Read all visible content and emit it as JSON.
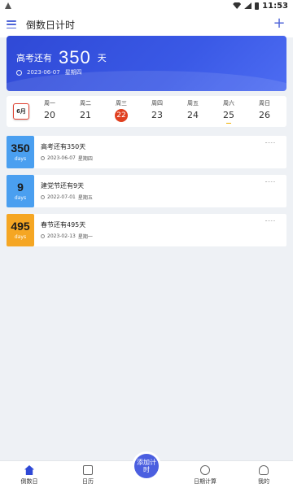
{
  "status_bar": {
    "time": "11:53"
  },
  "header": {
    "title": "倒数日计时",
    "add_icon": "plus-icon",
    "menu_icon": "menu-icon"
  },
  "banner": {
    "prefix": "高考还有",
    "number": "350",
    "unit": "天",
    "date": "2023-06-07",
    "weekday": "星期四"
  },
  "week": {
    "calendar_label": "6月",
    "days": [
      {
        "weekday": "周一",
        "day": "20"
      },
      {
        "weekday": "周二",
        "day": "21"
      },
      {
        "weekday": "周三",
        "day": "22"
      },
      {
        "weekday": "周四",
        "day": "23"
      },
      {
        "weekday": "周五",
        "day": "24"
      },
      {
        "weekday": "周六",
        "day": "25"
      },
      {
        "weekday": "周日",
        "day": "26"
      }
    ]
  },
  "cards": [
    {
      "number": "350",
      "unit": "days",
      "title": "高考还有350天",
      "date": "2023-06-07",
      "weekday": "星期四",
      "color": "#4a9ff0"
    },
    {
      "number": "9",
      "unit": "days",
      "title": "建党节还有9天",
      "date": "2022-07-01",
      "weekday": "星期五",
      "color": "#4a9ff0"
    },
    {
      "number": "495",
      "unit": "days",
      "title": "春节还有495天",
      "date": "2023-02-13",
      "weekday": "星期一",
      "color": "#f5a623"
    }
  ],
  "nav": {
    "items": [
      {
        "label": "倒数日"
      },
      {
        "label": "日历"
      },
      {
        "label": "添加计时"
      },
      {
        "label": "日期计算"
      },
      {
        "label": "我的"
      }
    ]
  },
  "colors": {
    "accent": "#2f49d6",
    "today": "#e04020",
    "card_blue": "#4a9ff0",
    "card_orange": "#f5a623"
  }
}
